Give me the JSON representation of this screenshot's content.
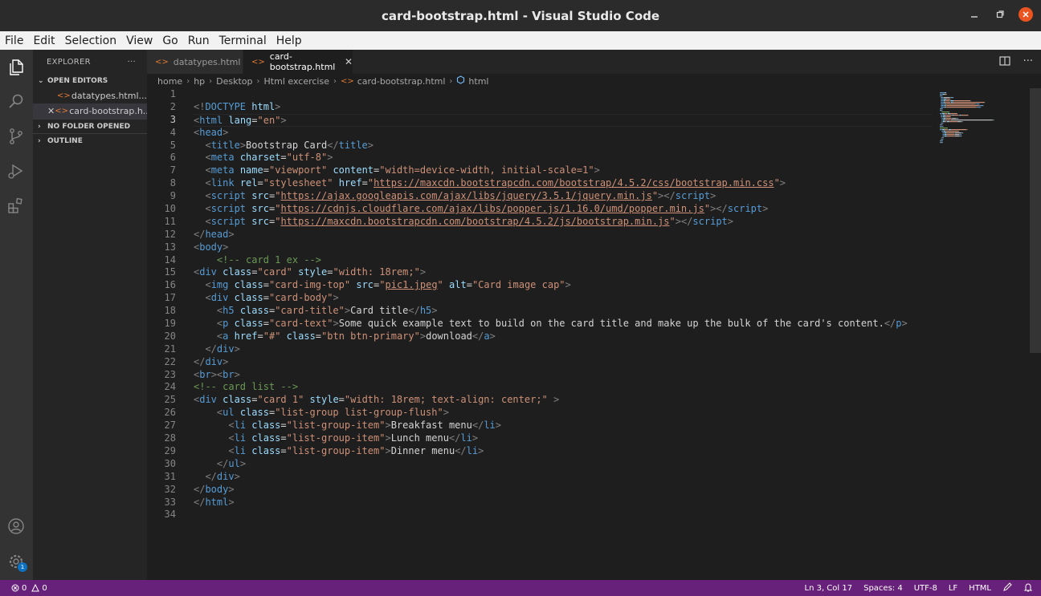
{
  "window": {
    "title": "card-bootstrap.html - Visual Studio Code"
  },
  "menu": [
    "File",
    "Edit",
    "Selection",
    "View",
    "Go",
    "Run",
    "Terminal",
    "Help"
  ],
  "sidebar": {
    "title": "EXPLORER",
    "more": "···",
    "open_editors": "OPEN EDITORS",
    "files": [
      {
        "name": "datatypes.html...",
        "close": ""
      },
      {
        "name": "card-bootstrap.h...",
        "close": "✕"
      }
    ],
    "no_folder": "NO FOLDER OPENED",
    "outline": "OUTLINE"
  },
  "tabs": [
    {
      "label": "datatypes.html"
    },
    {
      "label": "card-bootstrap.html",
      "close": "✕"
    }
  ],
  "breadcrumb": [
    "home",
    "hp",
    "Desktop",
    "Html excercise",
    "card-bootstrap.html",
    "html"
  ],
  "editor": {
    "current_line": 3,
    "lines": [
      [],
      [
        [
          "br",
          "<!"
        ],
        [
          "dt",
          "DOCTYPE"
        ],
        [
          "tx",
          " "
        ],
        [
          "at",
          "html"
        ],
        [
          "br",
          ">"
        ]
      ],
      [
        [
          "br",
          "<"
        ],
        [
          "tg",
          "html"
        ],
        [
          "tx",
          " "
        ],
        [
          "at",
          "lang"
        ],
        [
          "tx",
          "="
        ],
        [
          "st",
          "\"en\""
        ],
        [
          "br",
          ">"
        ]
      ],
      [
        [
          "br",
          "<"
        ],
        [
          "tg",
          "head"
        ],
        [
          "br",
          ">"
        ]
      ],
      [
        [
          "tx",
          "  "
        ],
        [
          "br",
          "<"
        ],
        [
          "tg",
          "title"
        ],
        [
          "br",
          ">"
        ],
        [
          "tx",
          "Bootstrap Card"
        ],
        [
          "br",
          "</"
        ],
        [
          "tg",
          "title"
        ],
        [
          "br",
          ">"
        ]
      ],
      [
        [
          "tx",
          "  "
        ],
        [
          "br",
          "<"
        ],
        [
          "tg",
          "meta"
        ],
        [
          "tx",
          " "
        ],
        [
          "at",
          "charset"
        ],
        [
          "tx",
          "="
        ],
        [
          "st",
          "\"utf-8\""
        ],
        [
          "br",
          ">"
        ]
      ],
      [
        [
          "tx",
          "  "
        ],
        [
          "br",
          "<"
        ],
        [
          "tg",
          "meta"
        ],
        [
          "tx",
          " "
        ],
        [
          "at",
          "name"
        ],
        [
          "tx",
          "="
        ],
        [
          "st",
          "\"viewport\""
        ],
        [
          "tx",
          " "
        ],
        [
          "at",
          "content"
        ],
        [
          "tx",
          "="
        ],
        [
          "st",
          "\"width=device-width, initial-scale=1\""
        ],
        [
          "br",
          ">"
        ]
      ],
      [
        [
          "tx",
          "  "
        ],
        [
          "br",
          "<"
        ],
        [
          "tg",
          "link"
        ],
        [
          "tx",
          " "
        ],
        [
          "at",
          "rel"
        ],
        [
          "tx",
          "="
        ],
        [
          "st",
          "\"stylesheet\""
        ],
        [
          "tx",
          " "
        ],
        [
          "at",
          "href"
        ],
        [
          "tx",
          "="
        ],
        [
          "st",
          "\""
        ],
        [
          "url",
          "https://maxcdn.bootstrapcdn.com/bootstrap/4.5.2/css/bootstrap.min.css"
        ],
        [
          "st",
          "\""
        ],
        [
          "br",
          ">"
        ]
      ],
      [
        [
          "tx",
          "  "
        ],
        [
          "br",
          "<"
        ],
        [
          "tg",
          "script"
        ],
        [
          "tx",
          " "
        ],
        [
          "at",
          "src"
        ],
        [
          "tx",
          "="
        ],
        [
          "st",
          "\""
        ],
        [
          "url",
          "https://ajax.googleapis.com/ajax/libs/jquery/3.5.1/jquery.min.js"
        ],
        [
          "st",
          "\""
        ],
        [
          "br",
          "></"
        ],
        [
          "tg",
          "script"
        ],
        [
          "br",
          ">"
        ]
      ],
      [
        [
          "tx",
          "  "
        ],
        [
          "br",
          "<"
        ],
        [
          "tg",
          "script"
        ],
        [
          "tx",
          " "
        ],
        [
          "at",
          "src"
        ],
        [
          "tx",
          "="
        ],
        [
          "st",
          "\""
        ],
        [
          "url",
          "https://cdnjs.cloudflare.com/ajax/libs/popper.js/1.16.0/umd/popper.min.js"
        ],
        [
          "st",
          "\""
        ],
        [
          "br",
          "></"
        ],
        [
          "tg",
          "script"
        ],
        [
          "br",
          ">"
        ]
      ],
      [
        [
          "tx",
          "  "
        ],
        [
          "br",
          "<"
        ],
        [
          "tg",
          "script"
        ],
        [
          "tx",
          " "
        ],
        [
          "at",
          "src"
        ],
        [
          "tx",
          "="
        ],
        [
          "st",
          "\""
        ],
        [
          "url",
          "https://maxcdn.bootstrapcdn.com/bootstrap/4.5.2/js/bootstrap.min.js"
        ],
        [
          "st",
          "\""
        ],
        [
          "br",
          "></"
        ],
        [
          "tg",
          "script"
        ],
        [
          "br",
          ">"
        ]
      ],
      [
        [
          "br",
          "</"
        ],
        [
          "tg",
          "head"
        ],
        [
          "br",
          ">"
        ]
      ],
      [
        [
          "br",
          "<"
        ],
        [
          "tg",
          "body"
        ],
        [
          "br",
          ">"
        ]
      ],
      [
        [
          "tx",
          "    "
        ],
        [
          "cm",
          "<!-- card 1 ex -->"
        ]
      ],
      [
        [
          "br",
          "<"
        ],
        [
          "tg",
          "div"
        ],
        [
          "tx",
          " "
        ],
        [
          "at",
          "class"
        ],
        [
          "tx",
          "="
        ],
        [
          "st",
          "\"card\""
        ],
        [
          "tx",
          " "
        ],
        [
          "at",
          "style"
        ],
        [
          "tx",
          "="
        ],
        [
          "st",
          "\"width: 18rem;\""
        ],
        [
          "br",
          ">"
        ]
      ],
      [
        [
          "tx",
          "  "
        ],
        [
          "br",
          "<"
        ],
        [
          "tg",
          "img"
        ],
        [
          "tx",
          " "
        ],
        [
          "at",
          "class"
        ],
        [
          "tx",
          "="
        ],
        [
          "st",
          "\"card-img-top\""
        ],
        [
          "tx",
          " "
        ],
        [
          "at",
          "src"
        ],
        [
          "tx",
          "="
        ],
        [
          "st",
          "\""
        ],
        [
          "url",
          "pic1.jpeg"
        ],
        [
          "st",
          "\""
        ],
        [
          "tx",
          " "
        ],
        [
          "at",
          "alt"
        ],
        [
          "tx",
          "="
        ],
        [
          "st",
          "\"Card image cap\""
        ],
        [
          "br",
          ">"
        ]
      ],
      [
        [
          "tx",
          "  "
        ],
        [
          "br",
          "<"
        ],
        [
          "tg",
          "div"
        ],
        [
          "tx",
          " "
        ],
        [
          "at",
          "class"
        ],
        [
          "tx",
          "="
        ],
        [
          "st",
          "\"card-body\""
        ],
        [
          "br",
          ">"
        ]
      ],
      [
        [
          "tx",
          "    "
        ],
        [
          "br",
          "<"
        ],
        [
          "tg",
          "h5"
        ],
        [
          "tx",
          " "
        ],
        [
          "at",
          "class"
        ],
        [
          "tx",
          "="
        ],
        [
          "st",
          "\"card-title\""
        ],
        [
          "br",
          ">"
        ],
        [
          "tx",
          "Card title"
        ],
        [
          "br",
          "</"
        ],
        [
          "tg",
          "h5"
        ],
        [
          "br",
          ">"
        ]
      ],
      [
        [
          "tx",
          "    "
        ],
        [
          "br",
          "<"
        ],
        [
          "tg",
          "p"
        ],
        [
          "tx",
          " "
        ],
        [
          "at",
          "class"
        ],
        [
          "tx",
          "="
        ],
        [
          "st",
          "\"card-text\""
        ],
        [
          "br",
          ">"
        ],
        [
          "tx",
          "Some quick example text to build on the card title and make up the bulk of the card's content."
        ],
        [
          "br",
          "</"
        ],
        [
          "tg",
          "p"
        ],
        [
          "br",
          ">"
        ]
      ],
      [
        [
          "tx",
          "    "
        ],
        [
          "br",
          "<"
        ],
        [
          "tg",
          "a"
        ],
        [
          "tx",
          " "
        ],
        [
          "at",
          "href"
        ],
        [
          "tx",
          "="
        ],
        [
          "st",
          "\"#\""
        ],
        [
          "tx",
          " "
        ],
        [
          "at",
          "class"
        ],
        [
          "tx",
          "="
        ],
        [
          "st",
          "\"btn btn-primary\""
        ],
        [
          "br",
          ">"
        ],
        [
          "tx",
          "download"
        ],
        [
          "br",
          "</"
        ],
        [
          "tg",
          "a"
        ],
        [
          "br",
          ">"
        ]
      ],
      [
        [
          "tx",
          "  "
        ],
        [
          "br",
          "</"
        ],
        [
          "tg",
          "div"
        ],
        [
          "br",
          ">"
        ]
      ],
      [
        [
          "br",
          "</"
        ],
        [
          "tg",
          "div"
        ],
        [
          "br",
          ">"
        ]
      ],
      [
        [
          "br",
          "<"
        ],
        [
          "tg",
          "br"
        ],
        [
          "br",
          "><"
        ],
        [
          "tg",
          "br"
        ],
        [
          "br",
          ">"
        ]
      ],
      [
        [
          "cm",
          "<!-- card list -->"
        ]
      ],
      [
        [
          "br",
          "<"
        ],
        [
          "tg",
          "div"
        ],
        [
          "tx",
          " "
        ],
        [
          "at",
          "class"
        ],
        [
          "tx",
          "="
        ],
        [
          "st",
          "\"card 1\""
        ],
        [
          "tx",
          " "
        ],
        [
          "at",
          "style"
        ],
        [
          "tx",
          "="
        ],
        [
          "st",
          "\"width: 18rem; text-align: center;\""
        ],
        [
          "tx",
          " "
        ],
        [
          "br",
          ">"
        ]
      ],
      [
        [
          "tx",
          "    "
        ],
        [
          "br",
          "<"
        ],
        [
          "tg",
          "ul"
        ],
        [
          "tx",
          " "
        ],
        [
          "at",
          "class"
        ],
        [
          "tx",
          "="
        ],
        [
          "st",
          "\"list-group list-group-flush\""
        ],
        [
          "br",
          ">"
        ]
      ],
      [
        [
          "tx",
          "      "
        ],
        [
          "br",
          "<"
        ],
        [
          "tg",
          "li"
        ],
        [
          "tx",
          " "
        ],
        [
          "at",
          "class"
        ],
        [
          "tx",
          "="
        ],
        [
          "st",
          "\"list-group-item\""
        ],
        [
          "br",
          ">"
        ],
        [
          "tx",
          "Breakfast menu"
        ],
        [
          "br",
          "</"
        ],
        [
          "tg",
          "li"
        ],
        [
          "br",
          ">"
        ]
      ],
      [
        [
          "tx",
          "      "
        ],
        [
          "br",
          "<"
        ],
        [
          "tg",
          "li"
        ],
        [
          "tx",
          " "
        ],
        [
          "at",
          "class"
        ],
        [
          "tx",
          "="
        ],
        [
          "st",
          "\"list-group-item\""
        ],
        [
          "br",
          ">"
        ],
        [
          "tx",
          "Lunch menu"
        ],
        [
          "br",
          "</"
        ],
        [
          "tg",
          "li"
        ],
        [
          "br",
          ">"
        ]
      ],
      [
        [
          "tx",
          "      "
        ],
        [
          "br",
          "<"
        ],
        [
          "tg",
          "li"
        ],
        [
          "tx",
          " "
        ],
        [
          "at",
          "class"
        ],
        [
          "tx",
          "="
        ],
        [
          "st",
          "\"list-group-item\""
        ],
        [
          "br",
          ">"
        ],
        [
          "tx",
          "Dinner menu"
        ],
        [
          "br",
          "</"
        ],
        [
          "tg",
          "li"
        ],
        [
          "br",
          ">"
        ]
      ],
      [
        [
          "tx",
          "    "
        ],
        [
          "br",
          "</"
        ],
        [
          "tg",
          "ul"
        ],
        [
          "br",
          ">"
        ]
      ],
      [
        [
          "tx",
          "  "
        ],
        [
          "br",
          "</"
        ],
        [
          "tg",
          "div"
        ],
        [
          "br",
          ">"
        ]
      ],
      [
        [
          "br",
          "</"
        ],
        [
          "tg",
          "body"
        ],
        [
          "br",
          ">"
        ]
      ],
      [
        [
          "br",
          "</"
        ],
        [
          "tg",
          "html"
        ],
        [
          "br",
          ">"
        ]
      ],
      []
    ]
  },
  "status": {
    "errors": "0",
    "warnings": "0",
    "position": "Ln 3, Col 17",
    "spaces": "Spaces: 4",
    "encoding": "UTF-8",
    "eol": "LF",
    "language": "HTML",
    "settings_badge": "1"
  },
  "colors": {
    "status_bar": "#68217a",
    "activity_bar": "#333333",
    "sidebar": "#252526",
    "editor": "#1e1e1e",
    "close_button": "#e95420"
  }
}
